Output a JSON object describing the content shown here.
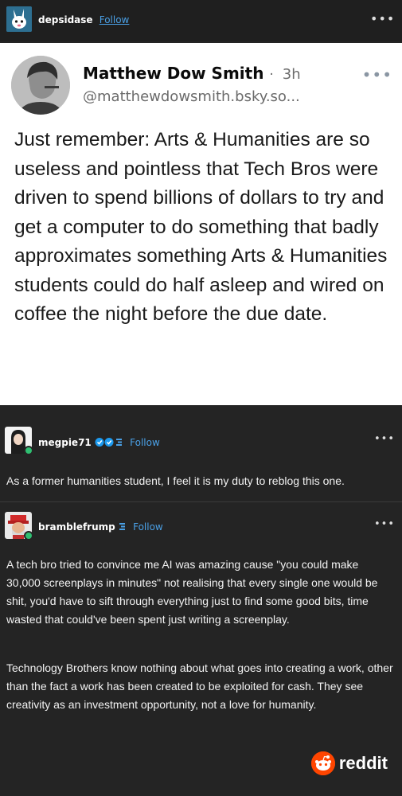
{
  "header": {
    "username": "depsidase",
    "follow_label": "Follow"
  },
  "embed": {
    "author_name": "Matthew Dow Smith",
    "separator": "·",
    "time": "3h",
    "handle": "@matthewdowsmith.bsky.so...",
    "text": "Just remember: Arts & Humanities are so useless and pointless that Tech Bros were driven to spend billions of dollars to try and get a computer to do something that badly approximates something Arts & Humanities students could do half asleep and wired on coffee the night before the due date."
  },
  "reblogs": [
    {
      "username": "megpie71",
      "follow_label": "Follow",
      "paragraphs": [
        "As a former humanities student, I feel it is my duty to reblog this one."
      ]
    },
    {
      "username": "bramblefrump",
      "follow_label": "Follow",
      "paragraphs": [
        "A tech bro tried to convince me AI was amazing cause \"you could make 30,000 screenplays in minutes\" not realising that every single one would be shit, you'd have to sift through everything just to find some good bits, time wasted that could've been spent just writing a screenplay.",
        "Technology Brothers know nothing about what goes into creating a work, other than the fact a work has been created to be exploited for cash. They see creativity as an investment opportunity, not a love for humanity."
      ]
    }
  ],
  "watermark": "reddit",
  "colors": {
    "background": "#242424",
    "link": "#4aa0e6",
    "verified": "#1d9bf0",
    "reddit": "#ff4500"
  }
}
